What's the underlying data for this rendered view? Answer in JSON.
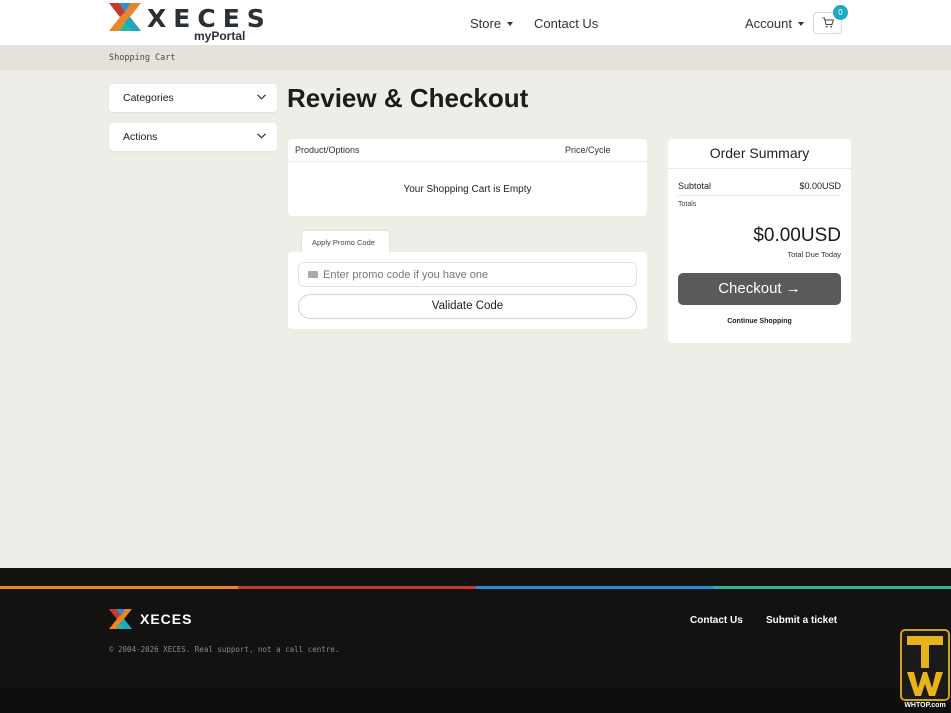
{
  "header": {
    "logo_word": "XECES",
    "logo_sub": "myPortal",
    "nav_store": "Store",
    "nav_contact": "Contact Us",
    "nav_account": "Account",
    "cart_count": "0"
  },
  "breadcrumb": "Shopping Cart",
  "sidebar": {
    "categories": "Categories",
    "actions": "Actions"
  },
  "main": {
    "title": "Review & Checkout",
    "cart": {
      "col_product": "Product/Options",
      "col_price": "Price/Cycle",
      "empty_text": "Your Shopping Cart is Empty"
    },
    "promo": {
      "tab_label": "Apply Promo Code",
      "placeholder": "Enter promo code if you have one",
      "validate_label": "Validate Code"
    }
  },
  "summary": {
    "title": "Order Summary",
    "subtotal_label": "Subtotal",
    "subtotal_value": "$0.00USD",
    "totals_label": "Totals",
    "total_value": "$0.00USD",
    "due_label": "Total Due Today",
    "checkout_label": "Checkout →",
    "continue_label": "Continue Shopping"
  },
  "footer": {
    "logo_word": "XECES",
    "link_contact": "Contact Us",
    "link_ticket": "Submit a ticket",
    "copyright": "© 2004-2026 XECES. Real support, not a call centre."
  },
  "colors": {
    "accent_teal": "#1ba8c1",
    "stripe_orange": "#e8862a",
    "stripe_red": "#c63a2d",
    "stripe_blue": "#2a8fd0",
    "stripe_teal": "#2bb59a",
    "checkout_bg": "#5a5a5a"
  },
  "watermark": "WHTOP.com"
}
